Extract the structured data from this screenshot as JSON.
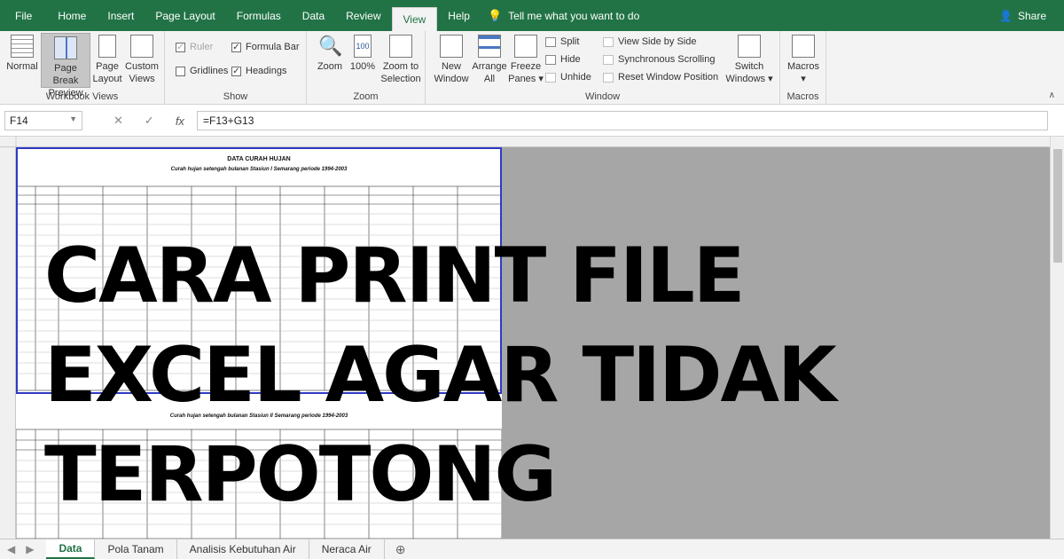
{
  "menu": {
    "items": [
      "File",
      "Home",
      "Insert",
      "Page Layout",
      "Formulas",
      "Data",
      "Review",
      "View",
      "Help"
    ],
    "active": "View",
    "tell_me": "Tell me what you want to do",
    "share": "Share"
  },
  "ribbon": {
    "workbook_views": {
      "label": "Workbook Views",
      "normal": "Normal",
      "page_break_1": "Page Break",
      "page_break_2": "Preview",
      "page_1": "Page",
      "page_2": "Layout",
      "custom_1": "Custom",
      "custom_2": "Views"
    },
    "show": {
      "label": "Show",
      "ruler": "Ruler",
      "formula_bar": "Formula Bar",
      "gridlines": "Gridlines",
      "headings": "Headings"
    },
    "zoom": {
      "label": "Zoom",
      "zoom": "Zoom",
      "hundred": "100%",
      "zoom_sel_1": "Zoom to",
      "zoom_sel_2": "Selection"
    },
    "window": {
      "label": "Window",
      "new_1": "New",
      "new_2": "Window",
      "arrange_1": "Arrange",
      "arrange_2": "All",
      "freeze_1": "Freeze",
      "freeze_2": "Panes ▾",
      "split": "Split",
      "hide": "Hide",
      "unhide": "Unhide",
      "side_by_side": "View Side by Side",
      "sync_scroll": "Synchronous Scrolling",
      "reset_pos": "Reset Window Position",
      "switch_1": "Switch",
      "switch_2": "Windows ▾"
    },
    "macros": {
      "label": "Macros",
      "btn": "Macros",
      "btn2": "▾"
    }
  },
  "formula_bar": {
    "cell": "F14",
    "formula": "=F13+G13"
  },
  "sheet": {
    "page1_title": "DATA CURAH HUJAN",
    "page1_subtitle": "Curah hujan setengah bulanan Stasiun I Semarang periode 1994-2003",
    "page2_subtitle": "Curah hujan setengah bulanan Stasiun II Semarang periode 1994-2003"
  },
  "overlay": {
    "line1": "CARA PRINT FILE",
    "line2": "EXCEL AGAR TIDAK",
    "line3": "TERPOTONG"
  },
  "tabs": {
    "items": [
      "Data",
      "Pola Tanam",
      "Analisis Kebutuhan Air",
      "Neraca Air"
    ],
    "active": "Data"
  }
}
